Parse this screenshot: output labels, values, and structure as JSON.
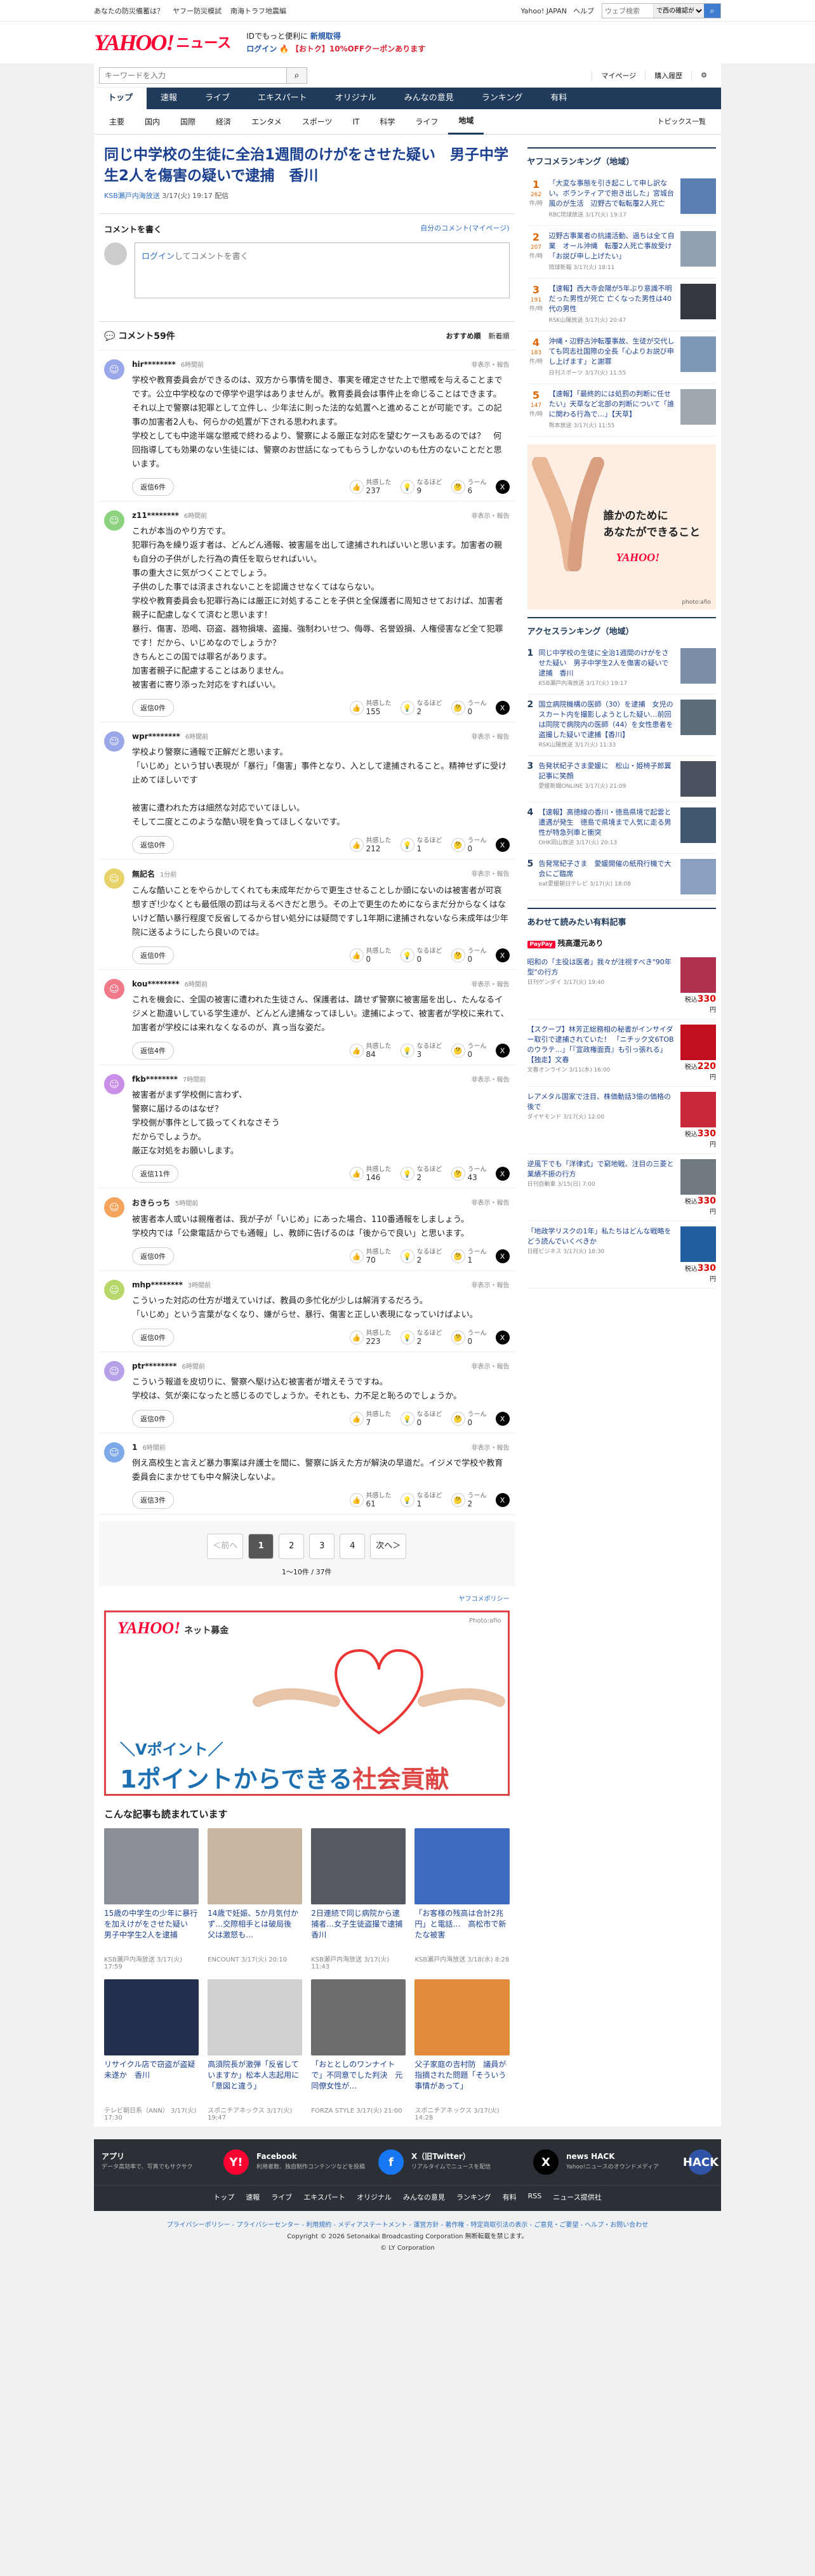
{
  "topbar": {
    "links": [
      "あなたの防災備蓄は？",
      "ヤフー防災模試",
      "南海トラフ地震編"
    ],
    "yahoo": "Yahoo! JAPAN",
    "help": "ヘルプ",
    "search_placeholder": "ウェブ検索",
    "region": "で西の確認が表...",
    "search_icon": "search-icon"
  },
  "header": {
    "logo_yahoo": "YAHOO!",
    "logo_japan": "JAPAN",
    "logo_news": "ニュース",
    "promo1": "IDでもっと便利に",
    "promo1_hl": "新規取得",
    "login": "ログイン",
    "promo2": "【おトク】10%OFFクーポンあります"
  },
  "searchrow": {
    "placeholder": "キーワードを入力",
    "mypage": "マイページ",
    "history": "購入履歴"
  },
  "gnav": [
    {
      "label": "トップ",
      "active": true
    },
    {
      "label": "速報"
    },
    {
      "label": "ライブ"
    },
    {
      "label": "エキスパート"
    },
    {
      "label": "オリジナル"
    },
    {
      "label": "みんなの意見"
    },
    {
      "label": "ランキング"
    },
    {
      "label": "有料"
    }
  ],
  "snav": {
    "items": [
      {
        "label": "主要"
      },
      {
        "label": "国内"
      },
      {
        "label": "国際"
      },
      {
        "label": "経済"
      },
      {
        "label": "エンタメ"
      },
      {
        "label": "スポーツ"
      },
      {
        "label": "IT"
      },
      {
        "label": "科学"
      },
      {
        "label": "ライフ"
      },
      {
        "label": "地域",
        "active": true
      }
    ],
    "right": "トピックス一覧"
  },
  "article": {
    "title": "同じ中学校の生徒に全治1週間のけがをさせた疑い　男子中学生2人を傷害の疑いで逮捕　香川",
    "source": "KSB瀬戸内海放送",
    "date": "3/17(火) 19:17 配信"
  },
  "cwrite": {
    "heading": "コメントを書く",
    "mine": "自分のコメント(マイページ)",
    "login": "ログイン",
    "placeholder": "してコメントを書く"
  },
  "ccount": {
    "label": "コメント59件",
    "sort1": "おすすめ順",
    "sort2": "新着順"
  },
  "comments": [
    {
      "name": "hir********",
      "time": "6時間前",
      "flag": "非表示・報告",
      "color": "#9aa7e8",
      "text": "学校や教育委員会ができるのは、双方から事情を聞き、事実を確定させた上で懲戒を与えることまでです。公立中学校なので停学や退学はありませんが。教育委員会は事件止を命じることはできます。\nそれ以上で警察は犯罪として立件し、少年法に則った法的な処置へと進めることが可能です。この記事の加害者2人も、何らかの処置が下される思われます。\n学校としても中途半端な懲戒で終わるより、警察による厳正な対応を望むケースもあるのでは？　何回指導しても効果のない生徒には、警察のお世話になってもらうしかないのも仕方のないことだと思います。",
      "reply": "返信6件",
      "a": "237",
      "b": "9",
      "c": "6"
    },
    {
      "name": "z11********",
      "time": "6時間前",
      "flag": "非表示・報告",
      "color": "#8cd27f",
      "text": "これが本当のやり方です。\n犯罪行為を繰り返す者は、どんどん通報、被害届を出して逮捕されればいいと思います。加害者の親も自分の子供がした行為の責任を取らせればいい。\n事の重大さに気がつくことでしょう。\n子供のした事では済まされないことを認識させなくてはならない。\n学校や教育委員会も犯罪行為には厳正に対処することを子供と全保護者に周知させておけば、加害者親子に配慮しなくて済むと思います！\n暴行、傷害、恐喝、窃盗、器物損壊、盗撮、強制わいせつ、侮辱、名誉毀損、人権侵害など全て犯罪です！だから、いじめなのでしょうか？\nきちんとこの国では罪名があります。\n加害者親子に配慮することはありません。\n被害者に寄り添った対応をすればいい。",
      "reply": "返信0件",
      "a": "155",
      "b": "2",
      "c": "0"
    },
    {
      "name": "wpr********",
      "time": "6時間前",
      "flag": "非表示・報告",
      "color": "#9aa7e8",
      "text": "学校より警察に通報で正解だと思います。\n「いじめ」という甘い表現が「暴行」「傷害」事件となり、入として逮捕されること。精神せずに受け止めてほしいです\n\n被害に遭われた方は細然な対応でいてほしい。\nそして二度とこのような酷い現を負ってほしくないです。",
      "reply": "返信0件",
      "a": "212",
      "b": "1",
      "c": "0"
    },
    {
      "name": "無記名",
      "time": "1分前",
      "flag": "非表示・報告",
      "color": "#e8d36b",
      "text": "こんな酷いことをやらかしてくれても未成年だからで更生させることしか頭にないのは被害者が可哀想すぎ!少なくとも最低限の罰は与えるべきだと思う。その上で更生のためにならまだ分からなくはないけど酷い暴行程度で反省してるから甘い処分には疑問ですし1年期に逮捕されないなら未成年は少年院に送るようにしたら良いのでは。",
      "reply": "返信0件",
      "a": "0",
      "b": "0",
      "c": "0"
    },
    {
      "name": "kou********",
      "time": "6時間前",
      "flag": "非表示・報告",
      "color": "#f17a8a",
      "text": "これを機会に、全国の被害に遭われた生徒さん、保護者は、躊せず警察に被害届を出し、たんなるイジメと勘違いしている学生達が、どんどん逮捕なってほしい。逮捕によって、被害者が学校に来れて、加害者が学校には来れなくなるのが、真っ当な姿だ。",
      "reply": "返信4件",
      "a": "84",
      "b": "3",
      "c": "0"
    },
    {
      "name": "fkb********",
      "time": "7時間前",
      "flag": "非表示・報告",
      "color": "#c88ee8",
      "text": "被害者がまず学校側に言わず、\n警察に届けるのはなぜ？\n学校側が事件として扱ってくれなさそう\nだからでしょうか。\n厳正な対処をお願いします。",
      "reply": "返信11件",
      "a": "146",
      "b": "2",
      "c": "43"
    },
    {
      "name": "おきらっち",
      "time": "5時間前",
      "flag": "非表示・報告",
      "color": "#f5a45e",
      "text": "被害者本人或いは親権者は、我が子が「いじめ」にあった場合、110番通報をしましょう。\n学校内では「公衆電話からでも通報」し、教師に告げるのは「後からで良い」と思います。",
      "reply": "返信0件",
      "a": "70",
      "b": "2",
      "c": "1"
    },
    {
      "name": "mhp********",
      "time": "3時間前",
      "flag": "非表示・報告",
      "color": "#b6d86a",
      "text": "こういった対応の仕方が増えていけば、教員の多忙化が少しは解消するだろう。\n「いじめ」という言葉がなくなり、嫌がらせ、暴行、傷害と正しい表現になっていけばよい。",
      "reply": "返信0件",
      "a": "223",
      "b": "2",
      "c": "0"
    },
    {
      "name": "ptr********",
      "time": "6時間前",
      "flag": "非表示・報告",
      "color": "#b6a2e8",
      "text": "こういう報道を皮切りに、警察へ駆け込む被害者が増えそうですね。\n学校は、気が楽になったと感じるのでしょうか。それとも、力不足と恥ろのでしょうか。",
      "reply": "返信0件",
      "a": "7",
      "b": "0",
      "c": "0"
    },
    {
      "name": "1",
      "time": "6時間前",
      "flag": "非表示・報告",
      "color": "#7ea9e8",
      "text": "例え高校生と言えど暴力事案は弁護士を間に、警察に訴えた方が解決の早道だ。イジメで学校や教育委員会にまかせても中々解決しないよ。",
      "reply": "返信3件",
      "a": "61",
      "b": "1",
      "c": "2"
    }
  ],
  "reacts": {
    "a": "共感した",
    "b": "なるほど",
    "c": "うーん"
  },
  "pager": {
    "prev": "＜前へ",
    "pages": [
      "1",
      "2",
      "3",
      "4"
    ],
    "next": "次へ＞",
    "info": "1～10件 / 37件"
  },
  "policy": "ヤフコメポリシー",
  "donate": {
    "brand": "YAHOO!",
    "brand_sub": "ネット募金",
    "photo": "Photo:afio",
    "tag1": "＼Vポイント／",
    "tag2a": "1ポイントからできる",
    "tag2b": "社会貢献"
  },
  "more": {
    "heading": "こんな記事も読まれています",
    "cards": [
      {
        "title": "15歳の中学生の少年に暴行を加えけがをさせた疑い　男子中学生2人を逮捕",
        "meta": "KSB瀬戸内海放送 3/17(火) 17:59",
        "color": "#8b8f96"
      },
      {
        "title": "14歳で妊娠、5か月気付かず…交際相手とは破局後　父は激怒も…",
        "meta": "ENCOUNT 3/17(火) 20:10",
        "color": "#c8b6a0"
      },
      {
        "title": "2日連続で同じ病院から逮捕者…女子生徒盗撮で逮捕　香川",
        "meta": "KSB瀬戸内海放送 3/17(火) 11:43",
        "color": "#555a60"
      },
      {
        "title": "「お客様の残高は合計2兆円」と電話…　高松市で新たな被害",
        "meta": "KSB瀬戸内海放送 3/18(水) 8:28",
        "color": "#3d6bc0"
      },
      {
        "title": "リサイクル店で窃盗が盗疑未遂か　香川",
        "meta": "テレビ朝日系（ANN） 3/17(火) 17:30",
        "color": "#253050"
      },
      {
        "title": "高須院長が激弾「反省していますか」松本人志起用に「意図と違う」",
        "meta": "スポニチアネックス 3/17(火) 19:47",
        "color": "#d0d0d0"
      },
      {
        "title": "「おととしのワンナイトで」不同意でした判決　元同僚女性が…",
        "meta": "FORZA STYLE 3/17(火) 21:00",
        "color": "#6d6d6d"
      },
      {
        "title": "父子家庭の吉村防　議員が指摘された問題「そういう事情があって」",
        "meta": "スポニチアネックス 3/17(火) 14:28",
        "color": "#e08a3a"
      }
    ]
  },
  "ranking": {
    "heading": "ヤフコメランキング（地域）",
    "items": [
      {
        "rank": "1",
        "count": "262",
        "lab": "件/時",
        "title": "「大変な事態を引き起こして申し訳ない。ボランティアで抱き出した」宮城台風のが生活　辺野古で転転覆2人死亡",
        "meta": "RBC琉球放送 3/17(火) 19:17",
        "color": "#5a7fb0"
      },
      {
        "rank": "2",
        "count": "207",
        "lab": "件/時",
        "title": "辺野古事業者の抗議活動、過ちは全て自業　オール沖縄　転覆2人死亡事故受け「お説び申し上げたい」",
        "meta": "琉球新報 3/17(火) 18:11",
        "color": "#90a0b0"
      },
      {
        "rank": "3",
        "count": "191",
        "lab": "件/時",
        "title": "【速報】西大寺会陽が5年ぶり意識不明だった男性が死亡 亡くなった男性は40代の男性",
        "meta": "RSK山陽放送 3/17(火) 20:47",
        "color": "#333840"
      },
      {
        "rank": "4",
        "count": "183",
        "lab": "件/時",
        "title": "沖縄・辺野古沖転覆事故、生徒が交代しても同志社国際の全長「心よりお説び申し上げます」と謝罪",
        "meta": "日刊スポーツ 3/17(火) 11:55",
        "color": "#8098b8"
      },
      {
        "rank": "5",
        "count": "147",
        "lab": "件/時",
        "title": "【速報】「最終的には処罰の判断に任せたい」天草など北部の判断について「誰に関わる行為で…」【天草】",
        "meta": "熊本放送 3/17(火) 11:55",
        "color": "#a0a8b0"
      }
    ]
  },
  "sidead": {
    "text1": "誰かのために",
    "text2": "あなたができること",
    "brand": "YAHOO!",
    "credit": "photo:afio"
  },
  "access": {
    "heading": "アクセスランキング（地域）",
    "items": [
      {
        "rank": "1",
        "title": "同じ中学校の生徒に全治1週間のけがをさせた疑い　男子中学生2人を傷害の疑いで逮捕　香川",
        "meta": "KSB瀬戸内海放送 3/17(火) 19:17",
        "color": "#7a8ea8"
      },
      {
        "rank": "2",
        "title": "国立病院機構の医師（30）を逮捕　女児のスカート内を撮影しようとした疑い…前回は同院で病院内の医師（44）を女性患者を盗撮した疑いで逮捕【香川】",
        "meta": "RSK山陽放送 3/17(火) 11:33",
        "color": "#5c6c78"
      },
      {
        "rank": "3",
        "title": "告発状紀子さま愛媛に　松山・姫椅子郎翼記事に笑顔",
        "meta": "愛媛新聞ONLINE 3/17(火) 21:09",
        "color": "#4a5260"
      },
      {
        "rank": "4",
        "title": "【速報】高徳線の香川・徳島県境で起雲と遭遇が発生　徳島で県境まで人気に走る男性が特急列車と衝突",
        "meta": "OHK岡山放送 3/17(火) 20:13",
        "color": "#405870"
      },
      {
        "rank": "5",
        "title": "告発常紀子さま　愛媛開催の紙飛行機で大会にご臨席",
        "meta": "eat愛媛朝日テレビ 3/17(火) 18:08",
        "color": "#8aa0c0"
      }
    ]
  },
  "pay": {
    "heading": "あわせて読みたい有料記事",
    "badge": "PayPay",
    "sub": "残高還元あり",
    "items": [
      {
        "title": "昭和の「主役は医者」我々が注視すべき\"90年型\"の行方",
        "meta": "日刊ゲンダイ 3/17(火) 19:40",
        "price": "330",
        "color": "#b03050"
      },
      {
        "title": "【スクープ】林芳正総務相の秘書がインサイダー取引で逮捕されていた！\n「ニチック文6TOBのウラテ…」「『宣政権面責』も引っ張れる」【独走】文春",
        "meta": "文春オンライン 3/11(水) 16:00",
        "price": "220",
        "color": "#c01020"
      },
      {
        "title": "レアメタル国家で注目、株価動話3億の価格の後で",
        "meta": "ダイヤモンド 3/17(火) 12:00",
        "price": "330",
        "color": "#c8283c"
      },
      {
        "title": "逆風下でも「洋律式」で窮地戦、注目の三菱と業績不振の行方",
        "meta": "日刊自動車 3/15(日) 7:00",
        "price": "330",
        "color": "#707880"
      },
      {
        "title": "「地政学リスクの1年」私たちはどんな戦略をどう読んでいくべきか",
        "meta": "日経ビジネス 3/17(火) 18:30",
        "price": "330",
        "color": "#2060a0"
      }
    ],
    "price_label": "税込",
    "yen": "円"
  },
  "footer": {
    "apps": [
      {
        "title": "アプリ",
        "text": "データ高効率で、写真でもサクサク",
        "icon": "Y!",
        "bg": "#f03"
      },
      {
        "title": "Facebook",
        "text": "利用者数、独自制作コンテンツなどを投稿",
        "icon": "f",
        "bg": "#1877f2"
      },
      {
        "title": "X（旧Twitter）",
        "text": "リアルタイムでニュースを配信",
        "icon": "X",
        "bg": "#000"
      },
      {
        "title": "news HACK",
        "text": "Yahoo!ニュースのオウンドメディア",
        "icon": "HACK",
        "bg": "#3055a8"
      }
    ],
    "nav": [
      "トップ",
      "速報",
      "ライブ",
      "エキスパート",
      "オリジナル",
      "みんなの意見",
      "ランキング",
      "有料",
      "RSS",
      "ニュース提供社"
    ]
  },
  "legal": {
    "links": "プライバシーポリシー - プライバシーセンター - 利用規約 - メディアステートメント - 運営方針 - 著作権 - 特定商取引法の表示 - ご意見・ご要望 - ヘルプ・お問い合わせ",
    "copy": "Copyright © 2026 Setonaikai Broadcasting Corporation 無断転載を禁じます。",
    "ly": "© LY Corporation"
  }
}
